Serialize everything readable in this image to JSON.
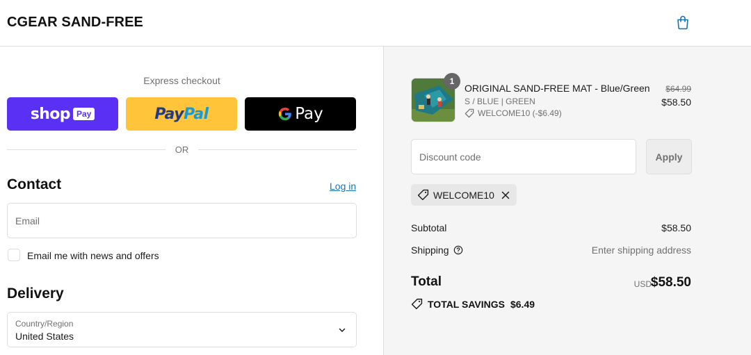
{
  "header": {
    "brand": "CGEAR SAND-FREE",
    "cart_icon": "shopping-bag-icon"
  },
  "express": {
    "label": "Express checkout",
    "buttons": [
      {
        "name": "shop-pay",
        "word": "shop",
        "badge": "Pay",
        "color": "#5a31f4"
      },
      {
        "name": "paypal",
        "part1": "Pay",
        "part2": "Pal",
        "color": "#ffc439"
      },
      {
        "name": "google-pay",
        "g": "G",
        "word": "Pay",
        "color": "#000000"
      }
    ],
    "divider": "OR"
  },
  "contact": {
    "title": "Contact",
    "login_link": "Log in",
    "email_placeholder": "Email",
    "newsletter_label": "Email me with news and offers",
    "newsletter_checked": false
  },
  "delivery": {
    "title": "Delivery",
    "country_label": "Country/Region",
    "country_value": "United States"
  },
  "summary": {
    "item": {
      "quantity": "1",
      "title": "ORIGINAL SAND-FREE MAT - Blue/Green",
      "variant": "S / BLUE | GREEN",
      "discount": "WELCOME10 (-$6.49)",
      "original_price": "$64.99",
      "price": "$58.50"
    },
    "discount_placeholder": "Discount code",
    "apply_label": "Apply",
    "applied_code": "WELCOME10",
    "subtotal_label": "Subtotal",
    "subtotal_value": "$58.50",
    "shipping_label": "Shipping",
    "shipping_value": "Enter shipping address",
    "total_label": "Total",
    "currency": "USD",
    "total_value": "$58.50",
    "savings_label": "TOTAL SAVINGS",
    "savings_value": "$6.49"
  },
  "colors": {
    "link": "#1773b0",
    "accent": "#5a31f4",
    "summary_bg": "#f5f5f5"
  }
}
